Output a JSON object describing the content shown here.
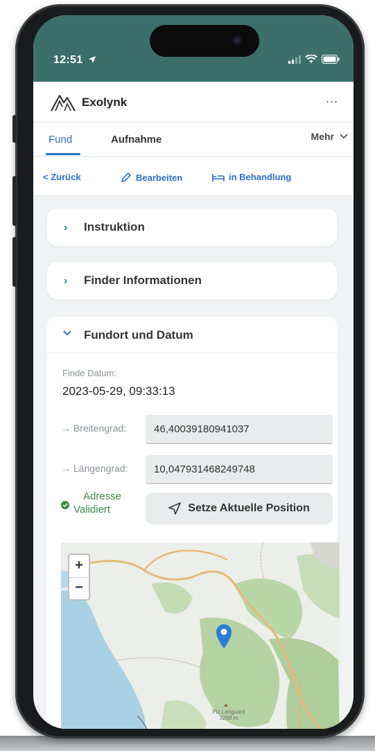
{
  "status_bar": {
    "time": "12:51"
  },
  "app": {
    "title": "Exolynk",
    "more": "..."
  },
  "tabs": [
    {
      "label": "Fund",
      "active": true
    },
    {
      "label": "Aufnahme",
      "active": false
    }
  ],
  "tabs_more": "Mehr",
  "toolbar": {
    "back": "< Zurück",
    "edit": "Bearbeiten",
    "status": "in Behandlung"
  },
  "panels": [
    {
      "title": "Instruktion",
      "expanded": false
    },
    {
      "title": "Finder Informationen",
      "expanded": false
    }
  ],
  "section": {
    "title": "Fundort und Datum",
    "date_label": "Finde Datum:",
    "date_value": "2023-05-29, 09:33:13",
    "lat_label": "→ Breitengrad:",
    "lat_value": "46,40039180941037",
    "lon_label": "→ Längengrad:",
    "lon_value": "10,047931468249748",
    "validated_line1": "Adresse",
    "validated_line2": "Validiert",
    "set_position_button": "Setze Aktuelle Position"
  },
  "map": {
    "zoom_in": "+",
    "zoom_out": "−",
    "peak_label_1": "Piz Languard",
    "peak_label_2": "3268 m"
  },
  "colors": {
    "header": "#3c6f6b",
    "accent": "#2a6fcd",
    "valid": "#3f8a48"
  },
  "icons": [
    "location-arrow-icon",
    "signal-icon",
    "wifi-icon",
    "battery-icon",
    "mountain-logo-icon",
    "pencil-icon",
    "bed-icon",
    "chevron-right-icon",
    "chevron-down-icon",
    "check-circle-icon",
    "navigation-icon",
    "map-pin-icon"
  ]
}
